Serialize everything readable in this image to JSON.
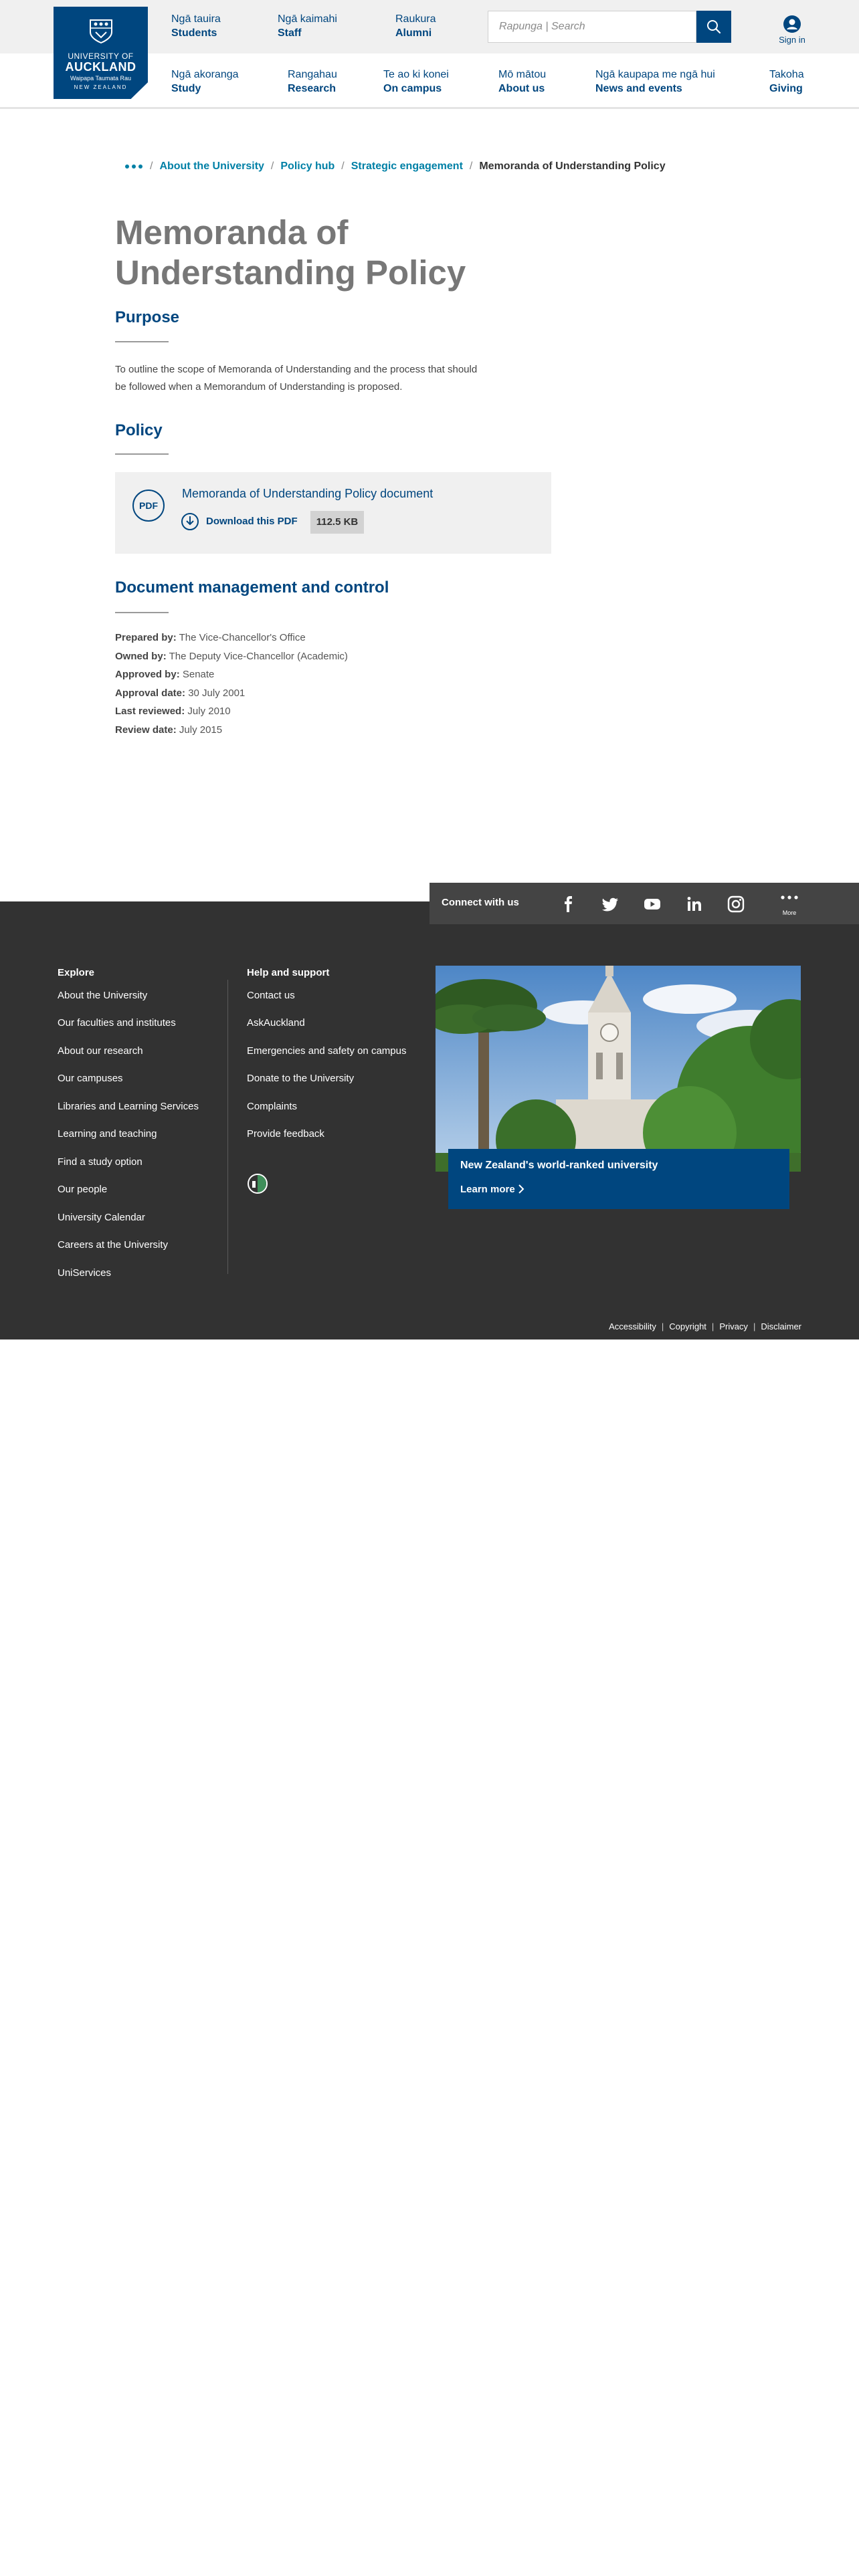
{
  "logo": {
    "line1": "UNIVERSITY OF",
    "line2": "AUCKLAND",
    "line3": "Waipapa Taumata Rau",
    "line4": "NEW ZEALAND"
  },
  "audience": [
    {
      "mi": "Ngā tauira",
      "en": "Students"
    },
    {
      "mi": "Ngā kaimahi",
      "en": "Staff"
    },
    {
      "mi": "Raukura",
      "en": "Alumni"
    }
  ],
  "search": {
    "placeholder": "Rapunga | Search"
  },
  "signin": {
    "label": "Sign in"
  },
  "mainnav": [
    {
      "mi": "Ngā akoranga",
      "en": "Study"
    },
    {
      "mi": "Rangahau",
      "en": "Research"
    },
    {
      "mi": "Te ao ki konei",
      "en": "On campus"
    },
    {
      "mi": "Mō mātou",
      "en": "About us"
    },
    {
      "mi": "Ngā kaupapa me ngā hui",
      "en": "News and events"
    },
    {
      "mi": "Takoha",
      "en": "Giving"
    }
  ],
  "breadcrumb": {
    "items": [
      "About the University",
      "Policy hub",
      "Strategic engagement"
    ],
    "current": "Memoranda of Understanding Policy"
  },
  "page": {
    "title": "Memoranda of Understanding Policy",
    "purpose_heading": "Purpose",
    "purpose_text": "To outline the scope of Memoranda of Understanding and the process that should be followed when a Memorandum of Understanding is proposed.",
    "policy_heading": "Policy",
    "document": {
      "icon_label": "PDF",
      "title": "Memoranda of Understanding Policy document",
      "download_label": "Download this PDF",
      "size": "112.5 KB"
    },
    "docmgmt_heading": "Document management and control",
    "meta": [
      {
        "label": "Prepared by",
        "value": "The Vice-Chancellor's Office"
      },
      {
        "label": "Owned by",
        "value": "The Deputy Vice-Chancellor (Academic)"
      },
      {
        "label": "Approved by",
        "value": "Senate"
      },
      {
        "label": "Approval date",
        "value": "30 July 2001"
      },
      {
        "label": "Last reviewed",
        "value": "July 2010"
      },
      {
        "label": "Review date",
        "value": "July 2015"
      }
    ]
  },
  "footer": {
    "connect_label": "Connect with us",
    "social": [
      "facebook-icon",
      "twitter-icon",
      "youtube-icon",
      "linkedin-icon",
      "instagram-icon",
      "more-icon"
    ],
    "more_label": "More",
    "explore_heading": "Explore",
    "explore_links": [
      "About the University",
      "Our faculties and institutes",
      "About our research",
      "Our campuses",
      "Libraries and Learning Services",
      "Learning and teaching",
      "Find a study option",
      "Our people",
      "University Calendar",
      "Careers at the University",
      "UniServices"
    ],
    "help_heading": "Help and support",
    "help_links": [
      "Contact us",
      "AskAuckland",
      "Emergencies and safety on campus",
      "Donate to the University",
      "Complaints",
      "Provide feedback"
    ],
    "promo_title": "New Zealand's world-ranked university",
    "promo_link": "Learn more",
    "legal_links": [
      "Accessibility",
      "Copyright",
      "Privacy",
      "Disclaimer"
    ]
  },
  "colors": {
    "brand_blue": "#00467f",
    "link_teal": "#0080a6",
    "footer_bg": "#323232",
    "header_bg": "#f0f0f0"
  }
}
